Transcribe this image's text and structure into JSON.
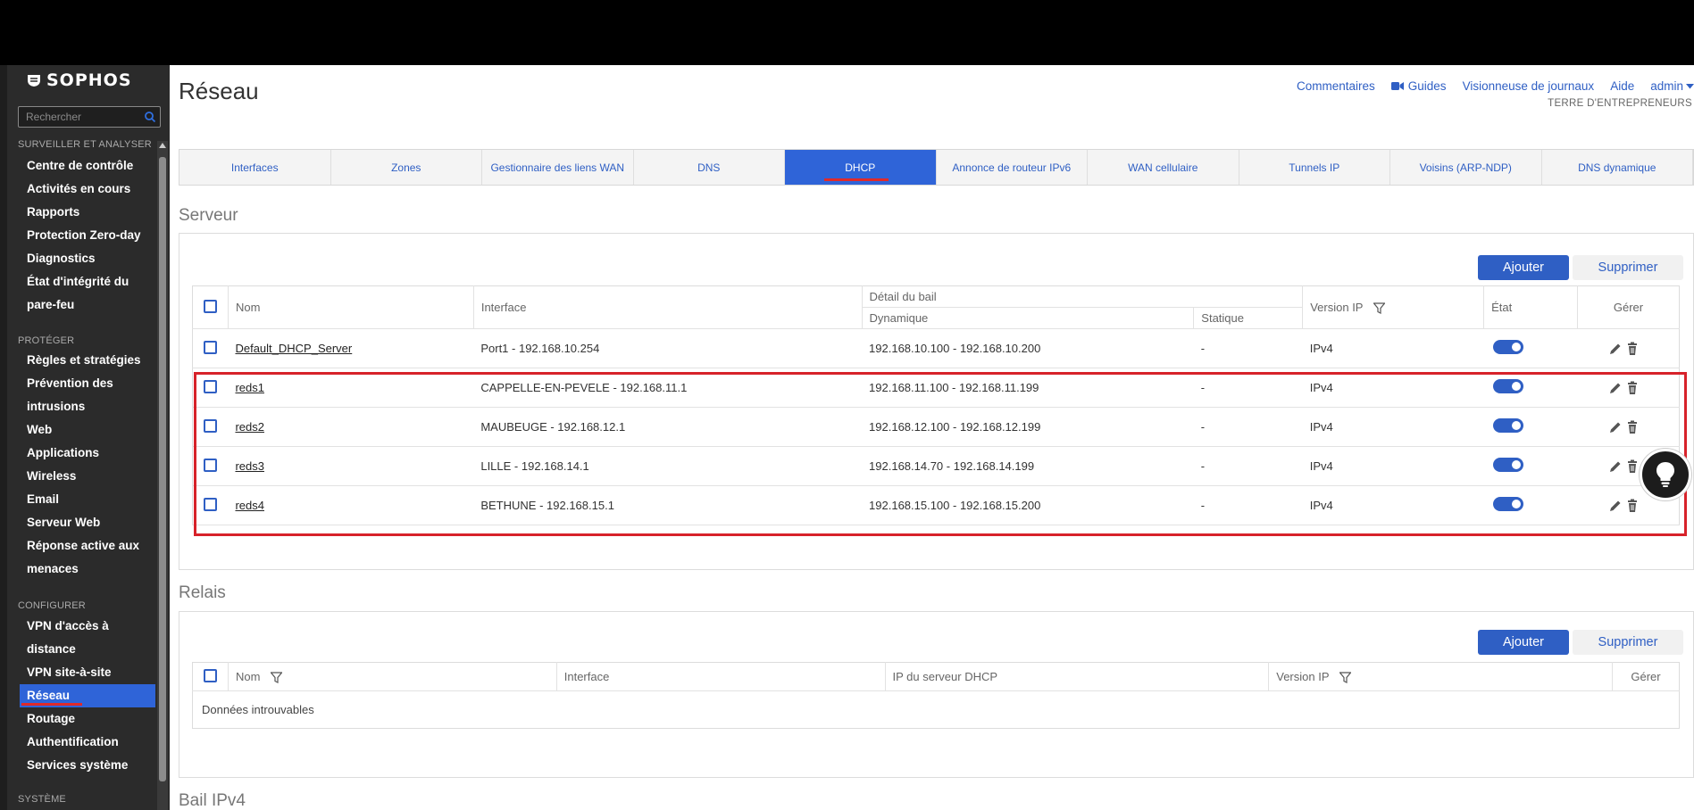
{
  "sidebar": {
    "logo": "SOPHOS",
    "search_placeholder": "Rechercher",
    "sections": {
      "monitor": "SURVEILLER ET ANALYSER",
      "protect": "PROTÉGER",
      "configure": "CONFIGURER",
      "system": "SYSTÈME"
    },
    "items": {
      "control_center": "Centre de contrôle",
      "current_activities": "Activités en cours",
      "reports": "Rapports",
      "zero_day": "Protection Zero-day",
      "diagnostics": "Diagnostics",
      "health_1": "État d'intégrité du",
      "health_2": "pare-feu",
      "rules": "Règles et stratégies",
      "ips_1": "Prévention des",
      "ips_2": "intrusions",
      "web": "Web",
      "applications": "Applications",
      "wireless": "Wireless",
      "email": "Email",
      "web_server": "Serveur Web",
      "active_response_1": "Réponse active aux",
      "active_response_2": "menaces",
      "remote_vpn_1": "VPN d'accès à",
      "remote_vpn_2": "distance",
      "site_vpn": "VPN site-à-site",
      "network": "Réseau",
      "routing": "Routage",
      "authentication": "Authentification",
      "system_services": "Services système"
    }
  },
  "header": {
    "title": "Réseau",
    "links": {
      "comments": "Commentaires",
      "guides": "Guides",
      "log_viewer": "Visionneuse de journaux",
      "help": "Aide",
      "admin": "admin"
    },
    "org": "TERRE D'ENTREPRENEURS"
  },
  "tabs": [
    "Interfaces",
    "Zones",
    "Gestionnaire des liens WAN",
    "DNS",
    "DHCP",
    "Annonce de routeur IPv6",
    "WAN cellulaire",
    "Tunnels IP",
    "Voisins (ARP-NDP)",
    "DNS dynamique"
  ],
  "active_tab": "DHCP",
  "server": {
    "title": "Serveur",
    "add_label": "Ajouter",
    "delete_label": "Supprimer",
    "headers": {
      "name": "Nom",
      "interface": "Interface",
      "lease_detail": "Détail du bail",
      "dynamic": "Dynamique",
      "static": "Statique",
      "ip_version": "Version IP",
      "state": "État",
      "manage": "Gérer"
    },
    "rows": [
      {
        "name": "Default_DHCP_Server",
        "interface": "Port1 - 192.168.10.254",
        "dynamic": "192.168.10.100 - 192.168.10.200",
        "static": "-",
        "ip_version": "IPv4"
      },
      {
        "name": "reds1",
        "interface": "CAPPELLE-EN-PEVELE - 192.168.11.1",
        "dynamic": "192.168.11.100 - 192.168.11.199",
        "static": "-",
        "ip_version": "IPv4"
      },
      {
        "name": "reds2",
        "interface": "MAUBEUGE - 192.168.12.1",
        "dynamic": "192.168.12.100 - 192.168.12.199",
        "static": "-",
        "ip_version": "IPv4"
      },
      {
        "name": "reds3",
        "interface": "LILLE - 192.168.14.1",
        "dynamic": "192.168.14.70 - 192.168.14.199",
        "static": "-",
        "ip_version": "IPv4"
      },
      {
        "name": "reds4",
        "interface": "BETHUNE - 192.168.15.1",
        "dynamic": "192.168.15.100 - 192.168.15.200",
        "static": "-",
        "ip_version": "IPv4"
      }
    ]
  },
  "relay": {
    "title": "Relais",
    "add_label": "Ajouter",
    "delete_label": "Supprimer",
    "headers": {
      "name": "Nom",
      "interface": "Interface",
      "dhcp_server_ip": "IP du serveur DHCP",
      "ip_version": "Version IP",
      "manage": "Gérer"
    },
    "empty_text": "Données introuvables"
  },
  "lease": {
    "title": "Bail IPv4"
  },
  "colors": {
    "accent": "#2f5fc4",
    "highlight": "#d7222a",
    "sidebar_bg": "#2b2b2b"
  }
}
